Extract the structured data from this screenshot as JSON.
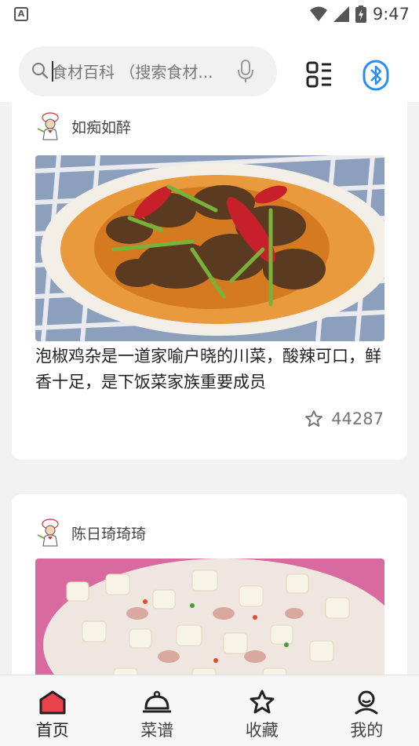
{
  "status_bar": {
    "time": "9:47",
    "app_badge": "A"
  },
  "search": {
    "placeholder": "食材百科 （搜索食材..."
  },
  "header_icons": {
    "scan": "qr-scan-icon",
    "bluetooth": "bluetooth-icon"
  },
  "feed": [
    {
      "author": "如痴如醉",
      "description": "泡椒鸡杂是一道家喻户晓的川菜，酸辣可口，鲜香十足，是下饭菜家族重要成员",
      "likes": "44287"
    },
    {
      "author": "陈日琦琦琦"
    }
  ],
  "tabs": [
    {
      "label": "首页",
      "icon": "home-icon",
      "active": true
    },
    {
      "label": "菜谱",
      "icon": "cloche-icon",
      "active": false
    },
    {
      "label": "收藏",
      "icon": "star-icon",
      "active": false
    },
    {
      "label": "我的",
      "icon": "user-icon",
      "active": false
    }
  ],
  "colors": {
    "accent": "#e8434b",
    "bluetooth": "#2a8ff0",
    "background": "#f2f2f2"
  }
}
